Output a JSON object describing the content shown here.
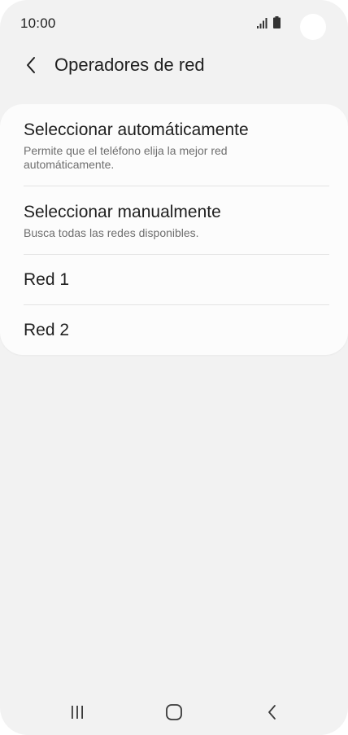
{
  "status_bar": {
    "time": "10:00",
    "signal_icon": "signal-bars-icon",
    "battery_icon": "battery-icon"
  },
  "header": {
    "title": "Operadores de red",
    "back_icon": "chevron-left-icon"
  },
  "items": [
    {
      "title": "Seleccionar automáticamente",
      "subtitle": "Permite que el teléfono elija la mejor red automáticamente."
    },
    {
      "title": "Seleccionar manualmente",
      "subtitle": "Busca todas las redes disponibles."
    },
    {
      "title": "Red 1"
    },
    {
      "title": "Red 2"
    }
  ],
  "nav_bar": {
    "recents_icon": "recents-icon",
    "home_icon": "home-icon",
    "back_icon": "back-icon"
  },
  "colors": {
    "background": "#f2f2f2",
    "card": "#fcfcfc",
    "text_primary": "#1f1f1f",
    "text_secondary": "#6e6e6e",
    "divider": "#e3e3e3"
  }
}
